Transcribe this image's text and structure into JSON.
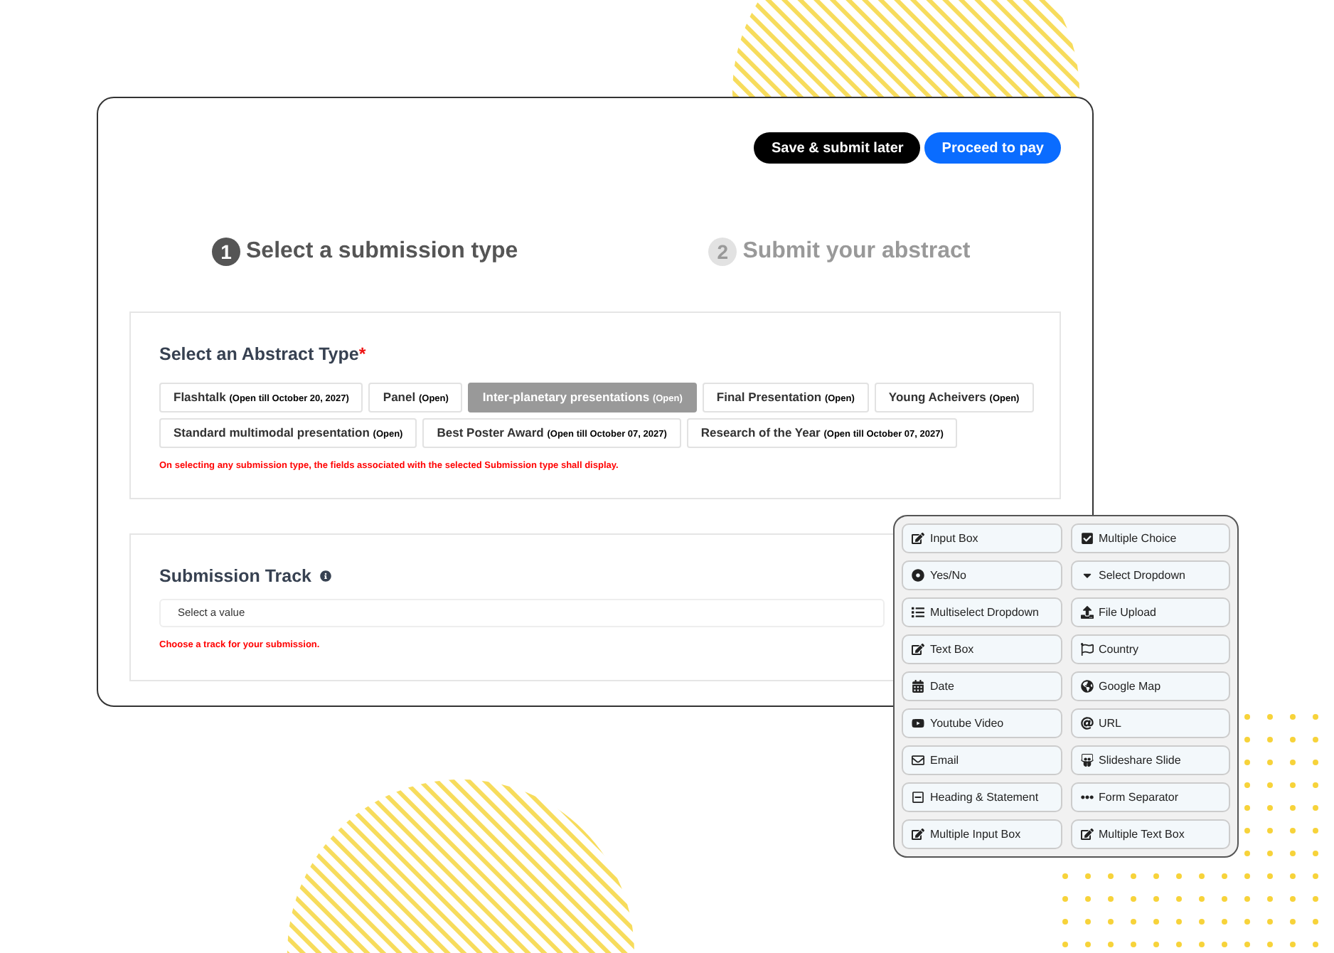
{
  "actions": [
    {
      "label": "Save & submit later",
      "kind": "dark"
    },
    {
      "label": "Proceed to pay",
      "kind": "primary"
    }
  ],
  "steps": [
    {
      "number": "1",
      "label": "Select a submission type",
      "selected": true
    },
    {
      "number": "2",
      "label": "Submit your abstract",
      "selected": false
    }
  ],
  "abstract_type": {
    "title": "Select an Abstract Type",
    "required_mark": "*",
    "options": [
      {
        "name": "Flashtalk",
        "status": "(Open till October 20, 2027)",
        "selected": false
      },
      {
        "name": "Panel",
        "status": "(Open)",
        "selected": false
      },
      {
        "name": "Inter-planetary presentations",
        "status": "(Open)",
        "selected": true
      },
      {
        "name": "Final Presentation",
        "status": "(Open)",
        "selected": false
      },
      {
        "name": "Young Acheivers",
        "status": "(Open)",
        "selected": false
      },
      {
        "name": "Standard multimodal presentation",
        "status": "(Open)",
        "selected": false
      },
      {
        "name": "Best Poster Award",
        "status": "(Open till October 07, 2027)",
        "selected": false
      },
      {
        "name": "Research of the Year",
        "status": "(Open till October 07, 2027)",
        "selected": false
      }
    ],
    "note": "On selecting any submission type, the fields associated with the selected Submission type shall display."
  },
  "submission_track": {
    "title": "Submission Track",
    "placeholder": "Select a value",
    "note": "Choose a track for your submission."
  },
  "field_palette": [
    {
      "label": "Input Box",
      "kind": "edit"
    },
    {
      "label": "Multiple Choice",
      "kind": "checkbox"
    },
    {
      "label": "Yes/No",
      "kind": "radio"
    },
    {
      "label": "Select Dropdown",
      "kind": "caret"
    },
    {
      "label": "Multiselect Dropdown",
      "kind": "list"
    },
    {
      "label": "File Upload",
      "kind": "upload"
    },
    {
      "label": "Text Box",
      "kind": "edit"
    },
    {
      "label": "Country",
      "kind": "flag"
    },
    {
      "label": "Date",
      "kind": "calendar"
    },
    {
      "label": "Google Map",
      "kind": "globe"
    },
    {
      "label": "Youtube Video",
      "kind": "video"
    },
    {
      "label": "URL",
      "kind": "at"
    },
    {
      "label": "Email",
      "kind": "mail"
    },
    {
      "label": "Slideshare Slide",
      "kind": "slides"
    },
    {
      "label": "Heading & Statement",
      "kind": "heading"
    },
    {
      "label": "Form Separator",
      "kind": "dots"
    },
    {
      "label": "Multiple Input Box",
      "kind": "edit"
    },
    {
      "label": "Multiple Text Box",
      "kind": "edit"
    }
  ]
}
